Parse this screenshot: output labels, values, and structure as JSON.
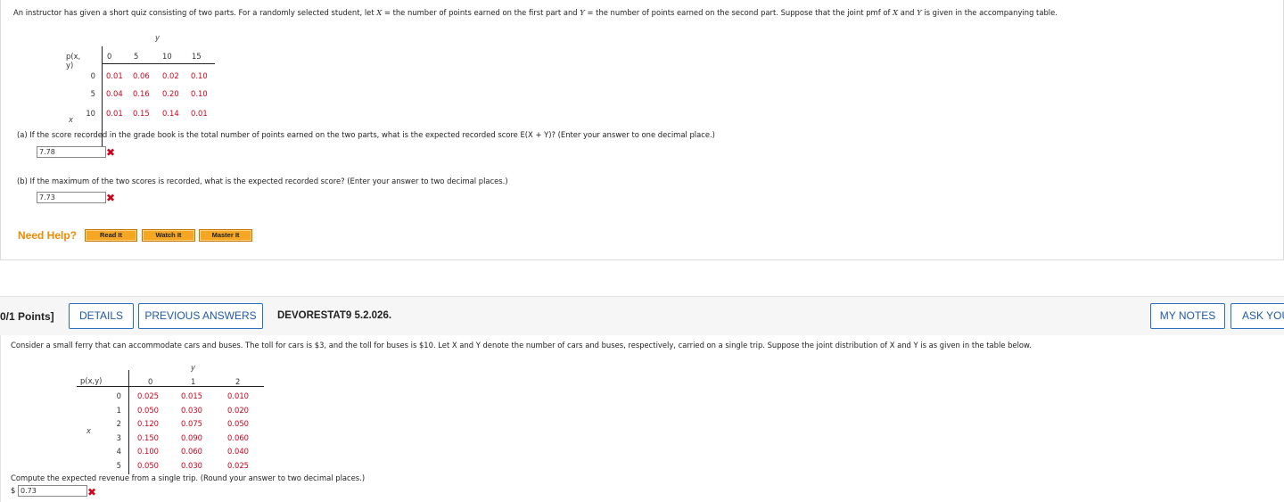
{
  "q1": {
    "intro_1": "An instructor has given a short quiz consisting of two parts. For a randomly selected student, let ",
    "intro_x": "X",
    "intro_2": " = the number of points earned on the first part and ",
    "intro_y": "Y",
    "intro_3": " = the number of points earned on the second part. Suppose that the joint pmf of ",
    "intro_x2": "X",
    "intro_4": " and ",
    "intro_y2": "Y",
    "intro_5": " is given in the accompanying table.",
    "table": {
      "y_label": "y",
      "x_label": "x",
      "corner_label": "p(x, y)",
      "col_headers": [
        "0",
        "5",
        "10",
        "15"
      ],
      "row_headers": [
        "0",
        "5",
        "10"
      ],
      "rows": [
        [
          "0.01",
          "0.06",
          "0.02",
          "0.10"
        ],
        [
          "0.04",
          "0.16",
          "0.20",
          "0.10"
        ],
        [
          "0.01",
          "0.15",
          "0.14",
          "0.01"
        ]
      ]
    },
    "part_a": {
      "text": "(a)  If the score recorded in the grade book is the total number of points earned on the two parts, what is the expected recorded score E(X + Y)? (Enter your answer to one decimal place.)",
      "answer": "7.78"
    },
    "part_b": {
      "text": "(b)  If the maximum of the two scores is recorded, what is the expected recorded score? (Enter your answer to two decimal places.)",
      "answer": "7.73"
    },
    "need_help": "Need Help?",
    "help_buttons": [
      "Read It",
      "Watch It",
      "Master It"
    ]
  },
  "q2": {
    "points": "0/1 Points]",
    "details": "DETAILS",
    "previous_answers": "PREVIOUS ANSWERS",
    "code": "DEVORESTAT9 5.2.026.",
    "my_notes": "MY NOTES",
    "ask_your": "ASK YOU",
    "intro": "Consider a small ferry that can accommodate cars and buses. The toll for cars is $3, and the toll for buses is $10. Let X and Y denote the number of cars and buses, respectively, carried on a single trip. Suppose the joint distribution of X and Y is as given in the table below.",
    "table": {
      "y_label": "y",
      "x_label": "x",
      "corner_label": "p(x,y)",
      "col_headers": [
        "0",
        "1",
        "2"
      ],
      "row_headers": [
        "0",
        "1",
        "2",
        "3",
        "4",
        "5"
      ],
      "rows": [
        [
          "0.025",
          "0.015",
          "0.010"
        ],
        [
          "0.050",
          "0.030",
          "0.020"
        ],
        [
          "0.120",
          "0.075",
          "0.050"
        ],
        [
          "0.150",
          "0.090",
          "0.060"
        ],
        [
          "0.100",
          "0.060",
          "0.040"
        ],
        [
          "0.050",
          "0.030",
          "0.025"
        ]
      ]
    },
    "question": "Compute the expected revenue from a single trip. (Round your answer to two decimal places.)",
    "currency": "$",
    "answer": "0.73"
  },
  "icons": {
    "wrong_mark": "✖"
  },
  "colors": {
    "cell_red": "#d0021b",
    "help_orange": "#f08a00",
    "button_blue": "#1f5aa6"
  }
}
